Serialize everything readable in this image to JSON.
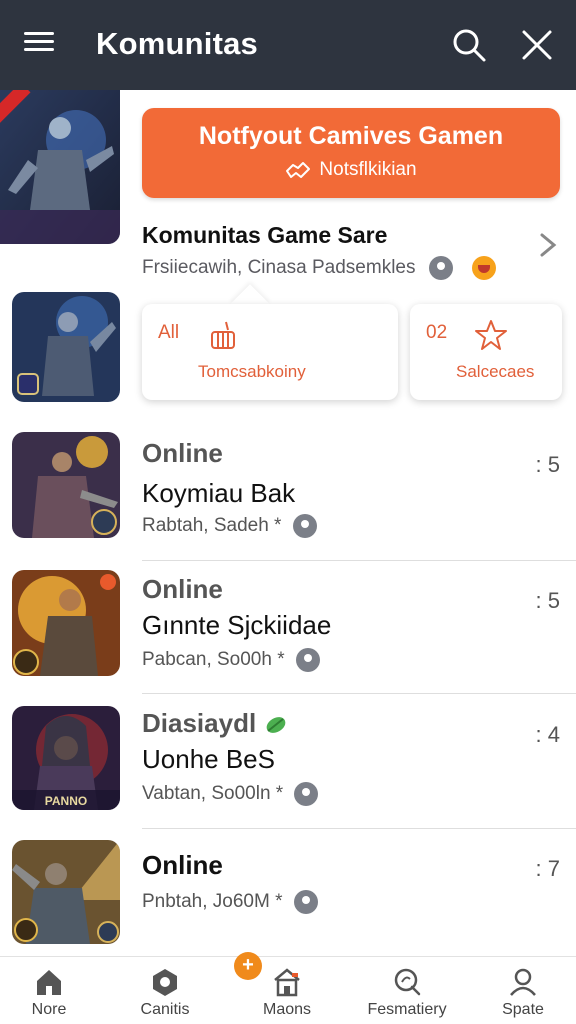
{
  "header": {
    "title": "Komunitas",
    "menu_icon": "menu-icon",
    "search_icon": "search-icon",
    "close_icon": "close-icon"
  },
  "notify": {
    "title": "Notfyout Camives Gamen",
    "subtitle": "Notsflkikian"
  },
  "featured": {
    "name": "Komunitas Game Sare",
    "description": "Frsiiecawih, Cinasa Padsemkles"
  },
  "categories": [
    {
      "number": "All",
      "label": "Tomcsabkoiny"
    },
    {
      "number": "02",
      "label": "Salcecaes"
    }
  ],
  "list": [
    {
      "status": "Online",
      "name": "Koymiau Bak",
      "meta": "Rabtah, Sadeh *",
      "count": ": 5"
    },
    {
      "status": "Online",
      "name": "Gınnte Sjckiidae",
      "meta": "Pabcan, So00h *",
      "count": ": 5"
    },
    {
      "status": "Diasiaydl",
      "name": "Uonhe BeS",
      "meta": "Vabtan, So00ln *",
      "count": ": 4"
    },
    {
      "status": "Online",
      "name": "",
      "meta": "Pnbtah, Jo60M *",
      "count": ": 7"
    }
  ],
  "nav": [
    {
      "label": "Nore",
      "icon": "home-icon"
    },
    {
      "label": "Canitis",
      "icon": "community-icon"
    },
    {
      "label": "Maons",
      "icon": "store-icon"
    },
    {
      "label": "Fesmatiery",
      "icon": "discover-icon"
    },
    {
      "label": "Spate",
      "icon": "profile-icon"
    }
  ],
  "nav_badge": "+",
  "thumb_badge": "PANNO",
  "colors": {
    "header_bg": "#2e343f",
    "accent": "#f26a37",
    "category_text": "#e1603a"
  }
}
